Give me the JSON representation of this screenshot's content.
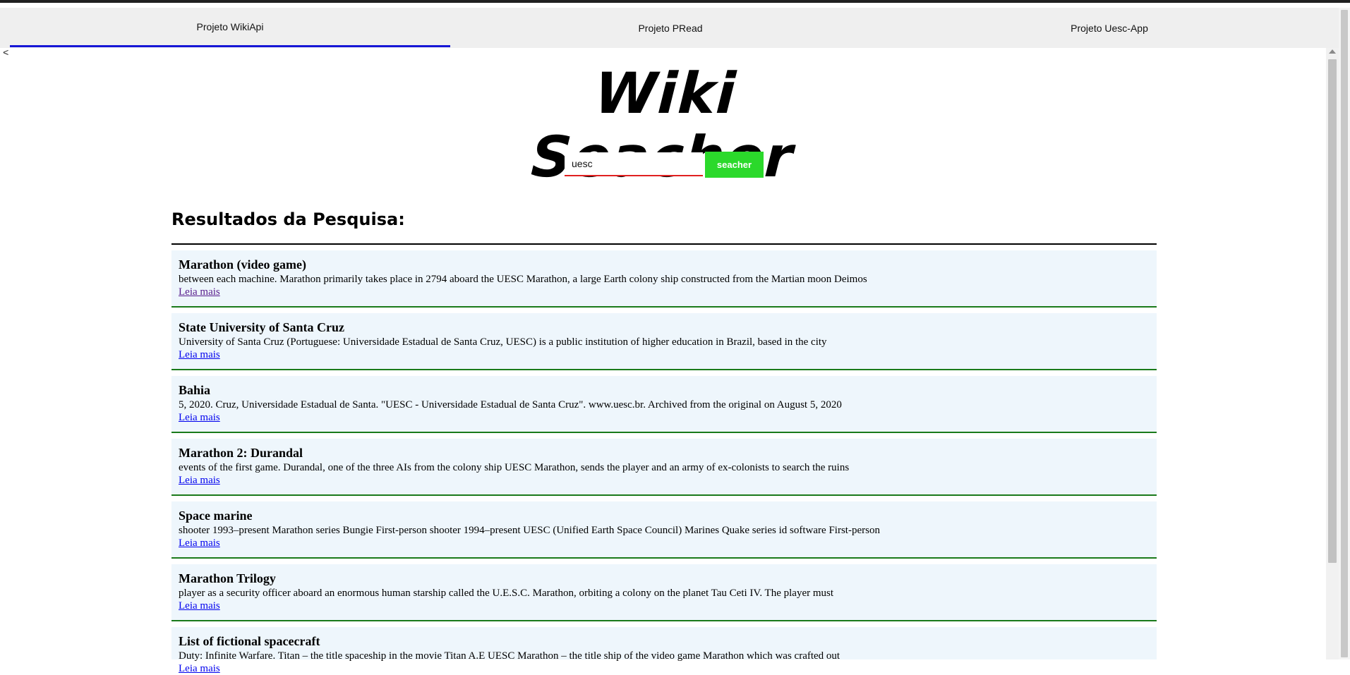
{
  "tabs": [
    {
      "label": "Projeto WikiApi",
      "active": true
    },
    {
      "label": "Projeto PRead",
      "active": false
    },
    {
      "label": "Projeto Uesc-App",
      "active": false
    }
  ],
  "back_label": "<",
  "brand_title": "Wiki Seacher",
  "search": {
    "value": "uesc",
    "button_label": "seacher"
  },
  "results_heading": "Resultados da Pesquisa:",
  "read_more_label": "Leia mais",
  "results": [
    {
      "title": "Marathon (video game)",
      "snippet": "between each machine. Marathon primarily takes place in 2794 aboard the UESC Marathon, a large Earth colony ship constructed from the Martian moon Deimos",
      "link": "Leia mais"
    },
    {
      "title": "State University of Santa Cruz",
      "snippet": "University of Santa Cruz (Portuguese: Universidade Estadual de Santa Cruz, UESC) is a public institution of higher education in Brazil, based in the city",
      "link": "Leia mais"
    },
    {
      "title": "Bahia",
      "snippet": "5, 2020. Cruz, Universidade Estadual de Santa. \"UESC - Universidade Estadual de Santa Cruz\". www.uesc.br. Archived from the original on August 5, 2020",
      "link": "Leia mais"
    },
    {
      "title": "Marathon 2: Durandal",
      "snippet": "events of the first game. Durandal, one of the three AIs from the colony ship UESC Marathon, sends the player and an army of ex-colonists to search the ruins",
      "link": "Leia mais"
    },
    {
      "title": "Space marine",
      "snippet": "shooter 1993–present Marathon series Bungie First-person shooter 1994–present UESC (Unified Earth Space Council) Marines Quake series id software First-person",
      "link": "Leia mais"
    },
    {
      "title": "Marathon Trilogy",
      "snippet": "player as a security officer aboard an enormous human starship called the U.E.S.C. Marathon, orbiting a colony on the planet Tau Ceti IV. The player must",
      "link": "Leia mais"
    },
    {
      "title": "List of fictional spacecraft",
      "snippet": "Duty: Infinite Warfare. Titan – the title spaceship in the movie Titan A.E UESC Marathon – the title ship of the video game Marathon which was crafted out",
      "link": "Leia mais"
    }
  ],
  "colors": {
    "tab_underline": "#1616d6",
    "search_button": "#2bd92b",
    "input_underline": "#e02020",
    "result_bg": "#eef6fc",
    "result_border": "#1a7a1a",
    "link": "#0000ee",
    "link_visited": "#551a8b"
  }
}
